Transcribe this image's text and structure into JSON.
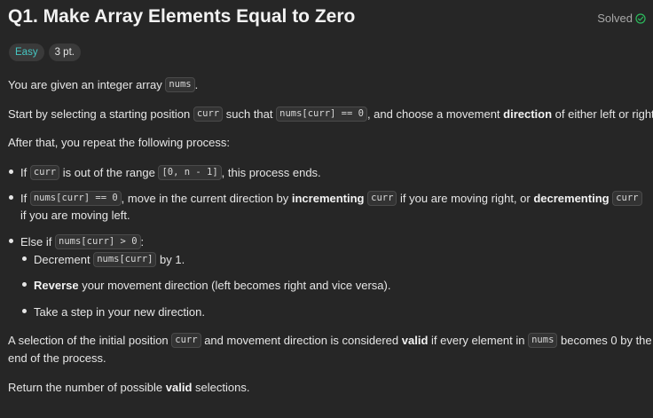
{
  "title": "Q1. Make Array Elements Equal to Zero",
  "status": {
    "label": "Solved",
    "icon": "check-circle-icon",
    "color": "#2cbb5d"
  },
  "badges": {
    "difficulty": "Easy",
    "points": "3 pt."
  },
  "colors": {
    "background": "#262626",
    "easy": "#46c6c2",
    "text": "#e6e6e6"
  },
  "p1": {
    "t1": "You are given an integer array ",
    "c1": "nums",
    "t2": "."
  },
  "p2": {
    "t1": "Start by selecting a starting position ",
    "c1": "curr",
    "t2": " such that ",
    "c2": "nums[curr] == 0",
    "t3": ", and choose a movement ",
    "b1": "direction",
    "t4": " of either left or right."
  },
  "p3": {
    "t1": "After that, you repeat the following process:"
  },
  "li1": {
    "t1": "If ",
    "c1": "curr",
    "t2": " is out of the range ",
    "c2": "[0, n - 1]",
    "t3": ", this process ends."
  },
  "li2": {
    "t1": "If ",
    "c1": "nums[curr] == 0",
    "t2": ", move in the current direction by ",
    "b1": "incrementing",
    "t3": " ",
    "c2": "curr",
    "t4": " if you are moving right, or ",
    "b2": "decrementing",
    "t5": " ",
    "c3": "curr",
    "t6": "if you are moving left."
  },
  "li3": {
    "t1": "Else if ",
    "c1": "nums[curr] > 0",
    "t2": ":"
  },
  "li3a": {
    "t1": "Decrement ",
    "c1": "nums[curr]",
    "t2": " by 1."
  },
  "li3b": {
    "b1": "Reverse",
    "t1": " your movement direction (left becomes right and vice versa)."
  },
  "li3c": {
    "t1": "Take a step in your new direction."
  },
  "p4": {
    "t1": "A selection of the initial position ",
    "c1": "curr",
    "t2": " and movement direction is considered ",
    "b1": "valid",
    "t3": " if every element in ",
    "c2": "nums",
    "t4": " becomes 0 by the",
    "t5": "end of the process."
  },
  "p5": {
    "t1": "Return the number of possible ",
    "b1": "valid",
    "t2": " selections."
  }
}
